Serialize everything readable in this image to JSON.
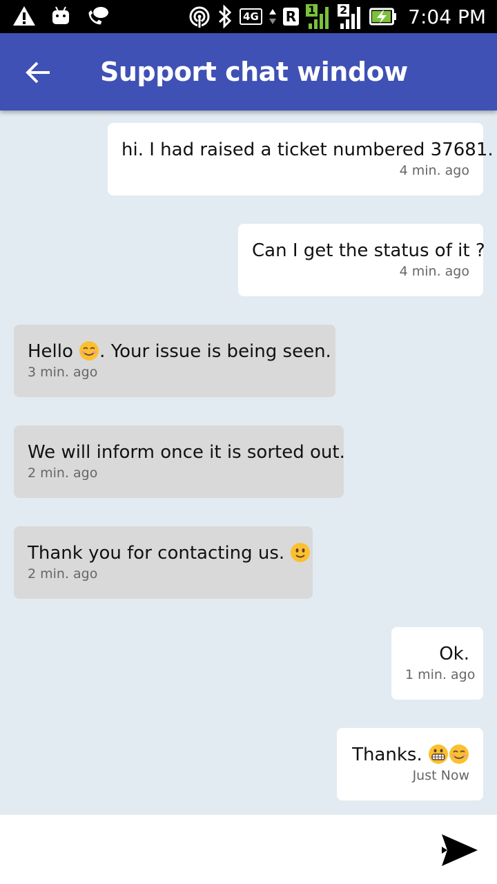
{
  "status_bar": {
    "network": "4G",
    "roaming": "R",
    "sim1": "1",
    "sim2": "2",
    "time": "7:04 PM",
    "icons": [
      "warning-icon",
      "android-icon",
      "wifi-calling-icon",
      "hotspot-icon",
      "bluetooth-icon",
      "battery-charging-icon"
    ]
  },
  "app_bar": {
    "title": "Support chat window",
    "back_icon": "arrow-back-icon",
    "color": "#3f51b5"
  },
  "messages": [
    {
      "direction": "out",
      "text": "hi. I had raised a ticket numbered 37681.",
      "time": "4 min. ago"
    },
    {
      "direction": "out",
      "text": "Can I get the status of it ?",
      "time": "4 min. ago"
    },
    {
      "direction": "in",
      "text_before": "Hello",
      "text_after": ". Your issue is being seen.",
      "emoji": "smiling-face-icon",
      "time": "3 min. ago"
    },
    {
      "direction": "in",
      "text": "We will inform once it is sorted out.",
      "time": "2 min. ago"
    },
    {
      "direction": "in",
      "text": "Thank you for contacting us.",
      "emoji": "slight-smile-icon",
      "time": "2 min. ago"
    },
    {
      "direction": "out",
      "text": "Ok.",
      "time": "1 min. ago"
    },
    {
      "direction": "out",
      "text": "Thanks.",
      "emojis": [
        "grimacing-face-icon",
        "smiling-face-icon"
      ],
      "time": "Just Now"
    }
  ],
  "input": {
    "placeholder": "",
    "send_icon": "send-icon"
  },
  "colors": {
    "background": "#e2ebf1",
    "incoming_bubble": "#d9d9d9",
    "outgoing_bubble": "#ffffff"
  }
}
